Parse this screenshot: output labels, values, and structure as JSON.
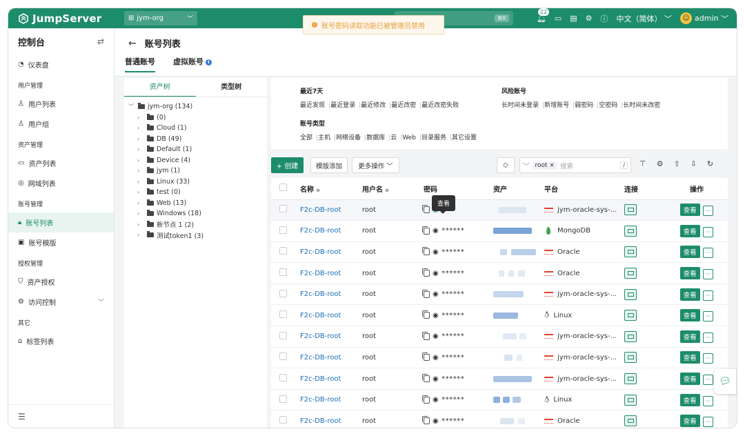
{
  "app": {
    "name": "JumpServer"
  },
  "topbar": {
    "org": "jym-org",
    "search_placeholder": "搜索",
    "search_shortcut": "⌘K",
    "notification_count": "22",
    "language": "中文（简体）",
    "user": "admin"
  },
  "toast": {
    "message": "账号密码读取功能已被管理员禁用"
  },
  "sidebar": {
    "console": "控制台",
    "dashboard": "仪表盘",
    "groups": {
      "users": "用户管理",
      "assets": "资产管理",
      "accounts": "账号管理",
      "perms": "授权管理",
      "other": "其它"
    },
    "items": {
      "user_list": "用户列表",
      "user_group": "用户组",
      "asset_list": "资产列表",
      "domain_list": "网域列表",
      "account_list": "账号列表",
      "account_template": "账号模版",
      "asset_perm": "资产授权",
      "access_control": "访问控制",
      "label_list": "标签列表"
    }
  },
  "page": {
    "title": "账号列表",
    "tabs": [
      "普通账号",
      "虚拟账号"
    ]
  },
  "tree": {
    "tabs": [
      "资产树",
      "类型树"
    ],
    "root": "jym-org (134)",
    "children": [
      "(0)",
      "Cloud (1)",
      "DB (49)",
      "Default (1)",
      "Device (4)",
      "jym (1)",
      "Linux (33)",
      "test (0)",
      "Web (13)",
      "Windows (18)",
      "新节点 1 (2)",
      "测试token1 (3)"
    ]
  },
  "filters": {
    "recent": {
      "head": "最近7天",
      "links": [
        "最近发现",
        "最近登录",
        "最近修改",
        "最近改密",
        "最近改密失败"
      ]
    },
    "risk": {
      "head": "风险账号",
      "links": [
        "长时间未登录",
        "新增账号",
        "弱密码",
        "空密码",
        "长时间未改密"
      ]
    },
    "type": {
      "head": "账号类型",
      "links": [
        "全部",
        "主机",
        "网络设备",
        "数据库",
        "云",
        "Web",
        "目录服务",
        "其它设置"
      ]
    }
  },
  "toolbar": {
    "create": "+ 创建",
    "template_add": "模版添加",
    "more_actions": "更多操作",
    "search_chip": "root ×",
    "search_placeholder": "搜索",
    "search_hotkey": "/"
  },
  "table": {
    "headers": [
      "名称",
      "用户名",
      "密码",
      "资产",
      "平台",
      "连接",
      "操作"
    ],
    "tooltip": "查看",
    "view_label": "查看",
    "more_label": "···",
    "rows": [
      {
        "name": "F2c-DB-root",
        "username": "root",
        "password": "--",
        "platform": "jym-oracle-sys-...",
        "platform_icon": "oracle-icon"
      },
      {
        "name": "F2c-DB-root",
        "username": "root",
        "password": "******",
        "platform": "MongoDB",
        "platform_icon": "mongodb-icon"
      },
      {
        "name": "F2c-DB-root",
        "username": "root",
        "password": "******",
        "platform": "Oracle",
        "platform_icon": "oracle-icon"
      },
      {
        "name": "F2c-DB-root",
        "username": "root",
        "password": "******",
        "platform": "Oracle",
        "platform_icon": "oracle-icon"
      },
      {
        "name": "F2c-DB-root",
        "username": "root",
        "password": "******",
        "platform": "jym-oracle-sys-...",
        "platform_icon": "oracle-icon"
      },
      {
        "name": "F2c-DB-root",
        "username": "root",
        "password": "******",
        "platform": "Linux",
        "platform_icon": "linux-icon"
      },
      {
        "name": "F2c-DB-root",
        "username": "root",
        "password": "******",
        "platform": "jym-oracle-sys-...",
        "platform_icon": "oracle-icon"
      },
      {
        "name": "F2c-DB-root",
        "username": "root",
        "password": "******",
        "platform": "jym-oracle-sys-...",
        "platform_icon": "oracle-icon"
      },
      {
        "name": "F2c-DB-root",
        "username": "root",
        "password": "******",
        "platform": "jym-oracle-sys-...",
        "platform_icon": "oracle-icon"
      },
      {
        "name": "F2c-DB-root",
        "username": "root",
        "password": "******",
        "platform": "Linux",
        "platform_icon": "linux-icon"
      },
      {
        "name": "F2c-DB-root",
        "username": "root",
        "password": "******",
        "platform": "Oracle",
        "platform_icon": "oracle-icon"
      }
    ]
  },
  "colors": {
    "brand": "#1d8c6b",
    "link": "#1d6fb8",
    "warning": "#e6a23c"
  }
}
